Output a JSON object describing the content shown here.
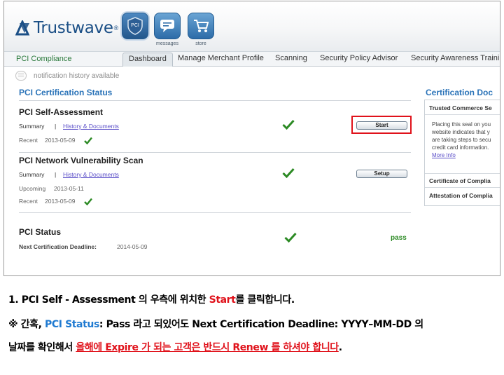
{
  "header": {
    "logo_text": "Trustwave",
    "logo_reg": "®",
    "icons": [
      {
        "name": "PCI",
        "label": ""
      },
      {
        "name": "messages",
        "label": "messages"
      },
      {
        "name": "store",
        "label": "store"
      }
    ],
    "pci_icon_text": "PCI"
  },
  "nav": {
    "brand": "PCI Compliance",
    "tabs": [
      "Dashboard",
      "Manage Merchant Profile",
      "Scanning",
      "Security Policy Advisor",
      "Security Awareness Traini"
    ]
  },
  "notification": {
    "text": "notification history available"
  },
  "main": {
    "title": "PCI Certification Status",
    "self_assessment": {
      "title": "PCI Self-Assessment",
      "summary": "Summary",
      "sep": "|",
      "link": "History & Documents",
      "recent_label": "Recent",
      "recent_date": "2013-05-09",
      "button": "Start"
    },
    "network_scan": {
      "title": "PCI Network Vulnerability Scan",
      "summary": "Summary",
      "sep": "|",
      "link": "History & Documents",
      "upcoming_label": "Upcoming",
      "upcoming_date": "2013-05-11",
      "recent_label": "Recent",
      "recent_date": "2013-05-09",
      "button": "Setup"
    },
    "status": {
      "title": "PCI Status",
      "deadline_label": "Next Certification Deadline:",
      "deadline_date": "2014-05-09",
      "result": "pass"
    }
  },
  "right_panel": {
    "title": "Certification Doc",
    "seal_head": "Trusted Commerce Se",
    "seal_lines": [
      "Placing this seal on you",
      "website indicates that y",
      "are taking steps to secu",
      "credit card information."
    ],
    "more_info": "More Info",
    "cert_head": "Certificate of Complia",
    "attest_head": "Attestation of Complia"
  },
  "caption": {
    "line1_a": "1. PCI Self - Assessment 의 우측에 위치한 ",
    "line1_b": "Start",
    "line1_c": "를 클릭합니다.",
    "line2_a": "※ 간혹, ",
    "line2_b": "PCI Status",
    "line2_c": ": Pass 라고 되있어도 Next Certification Deadline: YYYY–MM-DD 의",
    "line3_a": "날짜를 확인해서 ",
    "line3_b": "올해에 Expire 가 되는 고객은 반드시 Renew 를 하셔야 합니다",
    "line3_c": "."
  },
  "colors": {
    "accent_blue": "#2a73b8",
    "check_green": "#2c8a24",
    "highlight_red": "#e0121b",
    "link_purple": "#5a4ec8"
  }
}
